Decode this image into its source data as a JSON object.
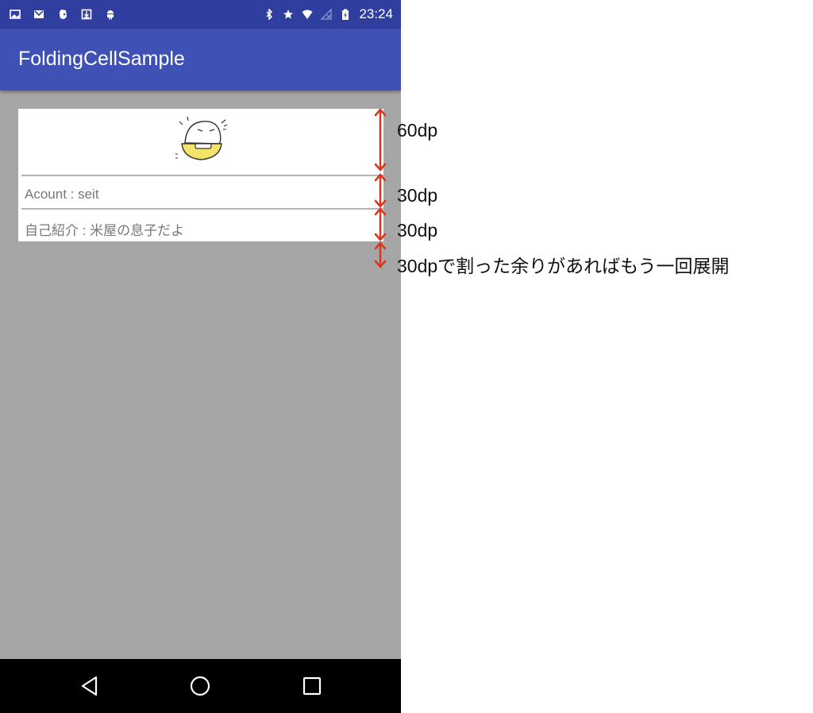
{
  "status_bar": {
    "time": "23:24",
    "left_icons": [
      "image-icon",
      "gmail-icon",
      "evernote-icon",
      "download-icon",
      "android-icon"
    ],
    "right_icons": [
      "bluetooth-icon",
      "star-icon",
      "wifi-icon",
      "no-signal-icon",
      "battery-charging-icon"
    ]
  },
  "app_bar": {
    "title": "FoldingCellSample"
  },
  "card": {
    "image_icon": "rice-bowl-character-icon",
    "account_text": "Acount : seit",
    "intro_text": "自己紹介 : 米屋の息子だよ"
  },
  "nav_bar": {
    "buttons": [
      "back-icon",
      "home-icon",
      "recents-icon"
    ]
  },
  "annotations": {
    "label_1": "60dp",
    "label_2": "30dp",
    "label_3": "30dp",
    "label_4": "30dpで割った余りがあればもう一回展開",
    "arrow_color": "#d9361e"
  },
  "colors": {
    "status_bar": "#303f9f",
    "app_bar": "#3f51b5",
    "screen_background": "#a6a6a6"
  }
}
